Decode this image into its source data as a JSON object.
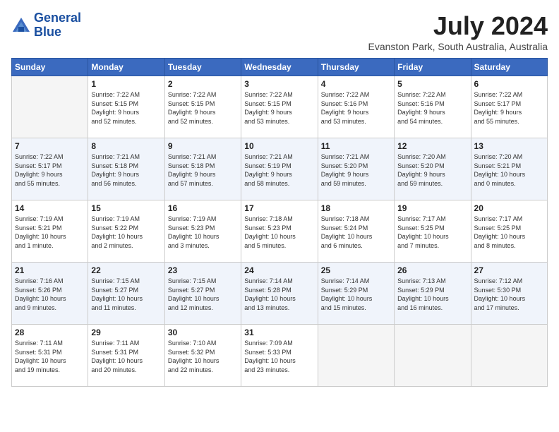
{
  "header": {
    "logo_text_line1": "General",
    "logo_text_line2": "Blue",
    "month_year": "July 2024",
    "location": "Evanston Park, South Australia, Australia"
  },
  "days_of_week": [
    "Sunday",
    "Monday",
    "Tuesday",
    "Wednesday",
    "Thursday",
    "Friday",
    "Saturday"
  ],
  "weeks": [
    [
      {
        "day": "",
        "info": ""
      },
      {
        "day": "1",
        "info": "Sunrise: 7:22 AM\nSunset: 5:15 PM\nDaylight: 9 hours\nand 52 minutes."
      },
      {
        "day": "2",
        "info": "Sunrise: 7:22 AM\nSunset: 5:15 PM\nDaylight: 9 hours\nand 52 minutes."
      },
      {
        "day": "3",
        "info": "Sunrise: 7:22 AM\nSunset: 5:15 PM\nDaylight: 9 hours\nand 53 minutes."
      },
      {
        "day": "4",
        "info": "Sunrise: 7:22 AM\nSunset: 5:16 PM\nDaylight: 9 hours\nand 53 minutes."
      },
      {
        "day": "5",
        "info": "Sunrise: 7:22 AM\nSunset: 5:16 PM\nDaylight: 9 hours\nand 54 minutes."
      },
      {
        "day": "6",
        "info": "Sunrise: 7:22 AM\nSunset: 5:17 PM\nDaylight: 9 hours\nand 55 minutes."
      }
    ],
    [
      {
        "day": "7",
        "info": "Sunrise: 7:22 AM\nSunset: 5:17 PM\nDaylight: 9 hours\nand 55 minutes."
      },
      {
        "day": "8",
        "info": "Sunrise: 7:21 AM\nSunset: 5:18 PM\nDaylight: 9 hours\nand 56 minutes."
      },
      {
        "day": "9",
        "info": "Sunrise: 7:21 AM\nSunset: 5:18 PM\nDaylight: 9 hours\nand 57 minutes."
      },
      {
        "day": "10",
        "info": "Sunrise: 7:21 AM\nSunset: 5:19 PM\nDaylight: 9 hours\nand 58 minutes."
      },
      {
        "day": "11",
        "info": "Sunrise: 7:21 AM\nSunset: 5:20 PM\nDaylight: 9 hours\nand 59 minutes."
      },
      {
        "day": "12",
        "info": "Sunrise: 7:20 AM\nSunset: 5:20 PM\nDaylight: 9 hours\nand 59 minutes."
      },
      {
        "day": "13",
        "info": "Sunrise: 7:20 AM\nSunset: 5:21 PM\nDaylight: 10 hours\nand 0 minutes."
      }
    ],
    [
      {
        "day": "14",
        "info": "Sunrise: 7:19 AM\nSunset: 5:21 PM\nDaylight: 10 hours\nand 1 minute."
      },
      {
        "day": "15",
        "info": "Sunrise: 7:19 AM\nSunset: 5:22 PM\nDaylight: 10 hours\nand 2 minutes."
      },
      {
        "day": "16",
        "info": "Sunrise: 7:19 AM\nSunset: 5:23 PM\nDaylight: 10 hours\nand 3 minutes."
      },
      {
        "day": "17",
        "info": "Sunrise: 7:18 AM\nSunset: 5:23 PM\nDaylight: 10 hours\nand 5 minutes."
      },
      {
        "day": "18",
        "info": "Sunrise: 7:18 AM\nSunset: 5:24 PM\nDaylight: 10 hours\nand 6 minutes."
      },
      {
        "day": "19",
        "info": "Sunrise: 7:17 AM\nSunset: 5:25 PM\nDaylight: 10 hours\nand 7 minutes."
      },
      {
        "day": "20",
        "info": "Sunrise: 7:17 AM\nSunset: 5:25 PM\nDaylight: 10 hours\nand 8 minutes."
      }
    ],
    [
      {
        "day": "21",
        "info": "Sunrise: 7:16 AM\nSunset: 5:26 PM\nDaylight: 10 hours\nand 9 minutes."
      },
      {
        "day": "22",
        "info": "Sunrise: 7:15 AM\nSunset: 5:27 PM\nDaylight: 10 hours\nand 11 minutes."
      },
      {
        "day": "23",
        "info": "Sunrise: 7:15 AM\nSunset: 5:27 PM\nDaylight: 10 hours\nand 12 minutes."
      },
      {
        "day": "24",
        "info": "Sunrise: 7:14 AM\nSunset: 5:28 PM\nDaylight: 10 hours\nand 13 minutes."
      },
      {
        "day": "25",
        "info": "Sunrise: 7:14 AM\nSunset: 5:29 PM\nDaylight: 10 hours\nand 15 minutes."
      },
      {
        "day": "26",
        "info": "Sunrise: 7:13 AM\nSunset: 5:29 PM\nDaylight: 10 hours\nand 16 minutes."
      },
      {
        "day": "27",
        "info": "Sunrise: 7:12 AM\nSunset: 5:30 PM\nDaylight: 10 hours\nand 17 minutes."
      }
    ],
    [
      {
        "day": "28",
        "info": "Sunrise: 7:11 AM\nSunset: 5:31 PM\nDaylight: 10 hours\nand 19 minutes."
      },
      {
        "day": "29",
        "info": "Sunrise: 7:11 AM\nSunset: 5:31 PM\nDaylight: 10 hours\nand 20 minutes."
      },
      {
        "day": "30",
        "info": "Sunrise: 7:10 AM\nSunset: 5:32 PM\nDaylight: 10 hours\nand 22 minutes."
      },
      {
        "day": "31",
        "info": "Sunrise: 7:09 AM\nSunset: 5:33 PM\nDaylight: 10 hours\nand 23 minutes."
      },
      {
        "day": "",
        "info": ""
      },
      {
        "day": "",
        "info": ""
      },
      {
        "day": "",
        "info": ""
      }
    ]
  ]
}
